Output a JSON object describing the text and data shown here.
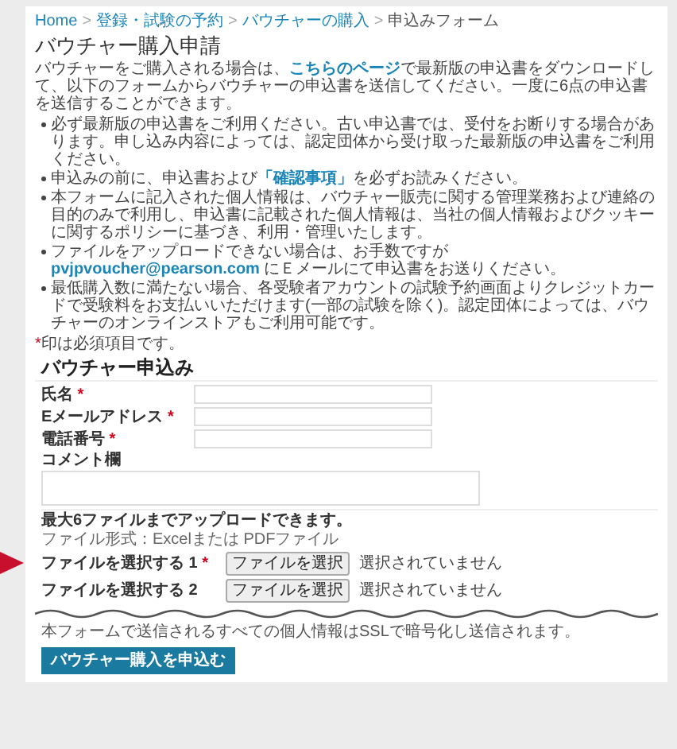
{
  "breadcrumb": {
    "links": [
      "Home",
      "登録・試験の予約",
      "バウチャーの購入"
    ],
    "current": "申込みフォーム",
    "separator": ">"
  },
  "title": "バウチャー購入申請",
  "intro": {
    "kind": "linked",
    "before": "バウチャーをご購入される場合は、",
    "link": "こちらのページ",
    "after": "で最新版の申込書をダウンロードして、以下のフォームからバウチャーの申込書を送信してください。一度に6点の申込書を送信することができます。"
  },
  "notes": [
    {
      "kind": "plain",
      "text": "必ず最新版の申込書をご利用ください。古い申込書では、受付をお断りする場合があります。申し込み内容によっては、認定団体から受け取った最新版の申込書をご利用ください。"
    },
    {
      "kind": "linked",
      "before": "申込みの前に、申込書および",
      "link": "「確認事項」",
      "after": "を必ずお読みください。"
    },
    {
      "kind": "plain",
      "text": "本フォームに記入された個人情報は、バウチャー販売に関する管理業務および連絡の目的のみで利用し、申込書に記載された個人情報は、当社の個人情報およびクッキーに関するポリシーに基づき、利用・管理いたします。"
    },
    {
      "kind": "linked",
      "before": "ファイルをアップロードできない場合は、お手数ですが ",
      "link": "pvjpvoucher@pearson.com",
      "after": " にＥメールにて申込書をお送りください。"
    },
    {
      "kind": "plain",
      "text": "最低購入数に満たない場合、各受験者アカウントの試験予約画面よりクレジットカードで受験料をお支払いいただけます(一部の試験を除く)。認定団体によっては、バウチャーのオンラインストアもご利用可能です。"
    }
  ],
  "required_note": {
    "mark": "*",
    "text": "印は必須項目です。"
  },
  "form": {
    "heading": "バウチャー申込み",
    "fields": [
      {
        "kind": "text",
        "label": "氏名",
        "required_mark": "*"
      },
      {
        "kind": "text",
        "label": "Eメールアドレス",
        "required_mark": "*"
      },
      {
        "kind": "text",
        "label": "電話番号",
        "required_mark": "*"
      },
      {
        "kind": "textarea",
        "label": "コメント欄"
      }
    ],
    "upload": {
      "title": "最大6ファイルまでアップロードできます。",
      "formats": "ファイル形式：Excelまたは PDFファイル",
      "files": [
        {
          "label": "ファイルを選択する 1",
          "required_mark": "*",
          "button": "ファイルを選択",
          "status": "選択されていません",
          "pointed": true
        },
        {
          "label": "ファイルを選択する 2",
          "button": "ファイルを選択",
          "status": "選択されていません",
          "pointed": false
        }
      ]
    },
    "ssl_note": "本フォームで送信されるすべての個人情報はSSLで暗号化し送信されます。",
    "submit": "バウチャー購入を申込む"
  }
}
